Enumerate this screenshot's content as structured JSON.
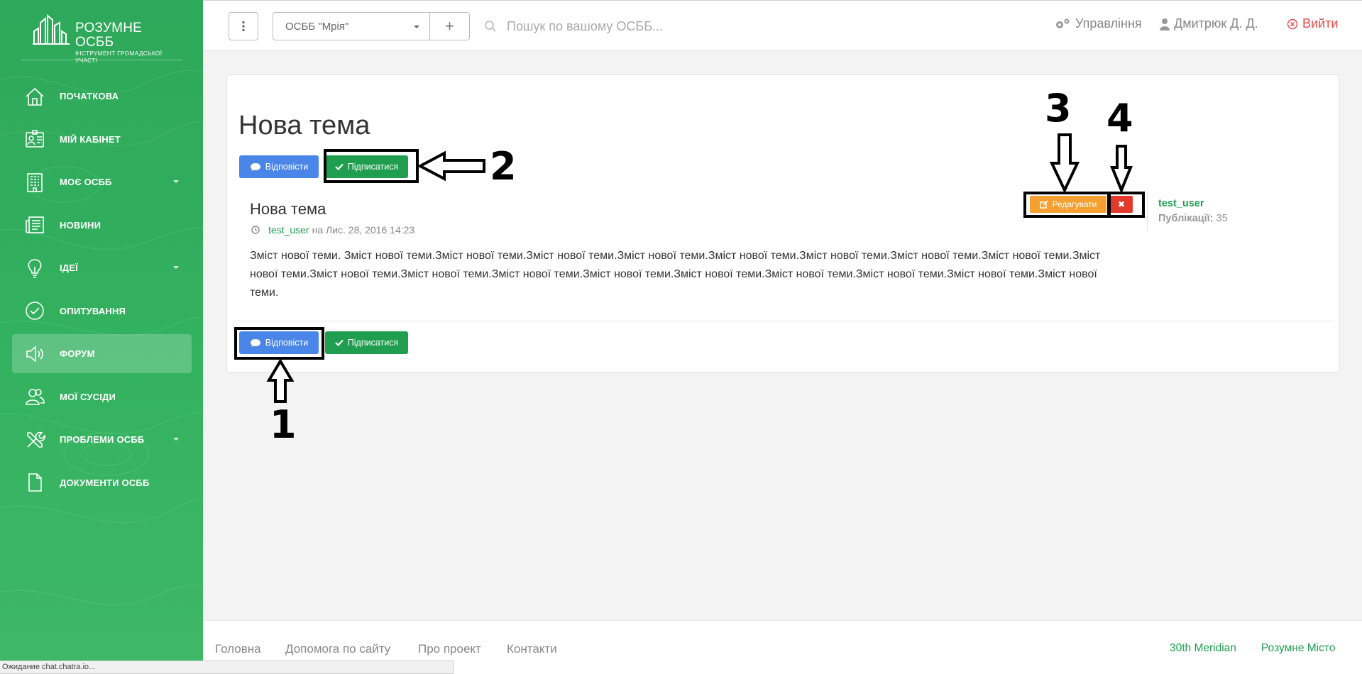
{
  "sidebar": {
    "logo": {
      "title": "РОЗУМНЕ ОСББ",
      "subtitle": "ІНСТРУМЕНТ ГРОМАДСЬКОЇ УЧАСТІ"
    },
    "items": [
      {
        "label": "ПОЧАТКОВА",
        "icon": "home-icon"
      },
      {
        "label": "МІЙ КАБІНЕТ",
        "icon": "profile-card-icon"
      },
      {
        "label": "МОЄ ОСББ",
        "icon": "building-icon"
      },
      {
        "label": "НОВИНИ",
        "icon": "newspaper-icon"
      },
      {
        "label": "ІДЕЇ",
        "icon": "lightbulb-icon"
      },
      {
        "label": "ОПИТУВАННЯ",
        "icon": "check-circle-icon"
      },
      {
        "label": "ФОРУМ",
        "icon": "speaker-icon"
      },
      {
        "label": "МОЇ СУСІДИ",
        "icon": "users-icon"
      },
      {
        "label": "ПРОБЛЕМИ ОСББ",
        "icon": "tools-icon"
      },
      {
        "label": "ДОКУМЕНТИ ОСББ",
        "icon": "document-icon"
      }
    ],
    "active": "ФОРУМ"
  },
  "topbar": {
    "osbb_select": "ОСББ \"Мрія\"",
    "add_label": "+",
    "search_placeholder": "Пошук по вашому ОСББ...",
    "manage_label": "Управління",
    "user_label": "Дмитрюк Д. Д.",
    "logout_label": "Вийти"
  },
  "topic": {
    "title": "Нова тема",
    "reply_label": "Відповісти",
    "subscribe_label": "Підписатися"
  },
  "post": {
    "title": "Нова тема",
    "author": "test_user",
    "date": "на Лис. 28, 2016 14:23",
    "body": "Зміст нової теми. Зміст нової теми.Зміст нової теми.Зміст нової теми.Зміст нової теми.Зміст нової теми.Зміст нової теми.Зміст нової теми.Зміст нової теми.Зміст нової теми.Зміст нової теми.Зміст нової теми.Зміст нової теми.Зміст нової теми.Зміст нової теми.Зміст нової теми.Зміст нової теми.Зміст нової теми.Зміст нової теми.",
    "edit_label": "Редагувати",
    "delete_label": "✖",
    "side_user": "test_user",
    "posts_label": "Публікації:",
    "posts_count": "35"
  },
  "annotations": {
    "n1": "1",
    "n2": "2",
    "n3": "3",
    "n4": "4"
  },
  "footer": {
    "links": [
      "Головна",
      "Допомога по сайту",
      "Про проект",
      "Контакти"
    ],
    "right_links": [
      "30th Meridian",
      "Розумне Місто"
    ]
  },
  "statusbar": {
    "text": "Ожидание chat.chatra.io..."
  },
  "colors": {
    "sidebar_green": "#33b25f",
    "primary_blue": "#4a86e8",
    "success_green": "#1e9e4e",
    "edit_orange": "#f5a030",
    "delete_red": "#e23b2e",
    "logout_red": "#e84a4a"
  }
}
